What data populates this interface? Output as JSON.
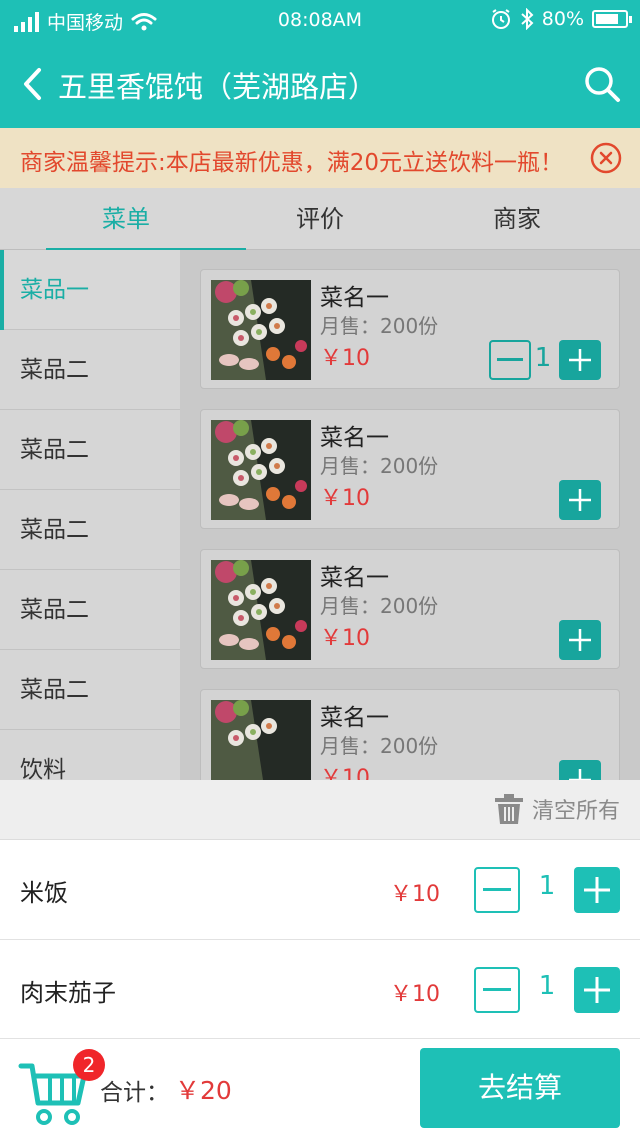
{
  "status_bar": {
    "carrier": "中国移动",
    "time": "08:08AM",
    "battery": "80%",
    "battery_level": 0.8
  },
  "header": {
    "title": "五里香馄饨（芜湖路店）"
  },
  "notice": {
    "text": "商家温馨提示:本店最新优惠，满20元立送饮料一瓶！"
  },
  "tabs": [
    {
      "label": "菜单",
      "active": true
    },
    {
      "label": "评价",
      "active": false
    },
    {
      "label": "商家",
      "active": false
    }
  ],
  "sidebar": {
    "items": [
      {
        "label": "菜品一",
        "active": true
      },
      {
        "label": "菜品二"
      },
      {
        "label": "菜品二"
      },
      {
        "label": "菜品二"
      },
      {
        "label": "菜品二"
      },
      {
        "label": "菜品二"
      },
      {
        "label": "饮料"
      }
    ]
  },
  "menu": {
    "items": [
      {
        "name": "菜名一",
        "sold": "月售：200份",
        "price": "￥10",
        "qty": "1"
      },
      {
        "name": "菜名一",
        "sold": "月售：200份",
        "price": "￥10"
      },
      {
        "name": "菜名一",
        "sold": "月售：200份",
        "price": "￥10"
      },
      {
        "name": "菜名一",
        "sold": "月售：200份",
        "price": "￥10"
      }
    ]
  },
  "cart": {
    "clear_label": "清空所有",
    "items": [
      {
        "name": "米饭",
        "price": "￥10",
        "qty": "1"
      },
      {
        "name": "肉末茄子",
        "price": "￥10",
        "qty": "1"
      }
    ]
  },
  "footer": {
    "badge": "2",
    "total_label": "合计：",
    "total": "￥20",
    "checkout_label": "去结算"
  },
  "colors": {
    "primary": "#1ec0b6",
    "price": "#e23a3a",
    "notice_bg": "#efe2c4",
    "notice_text": "#e2482d",
    "badge": "#f0262a"
  }
}
